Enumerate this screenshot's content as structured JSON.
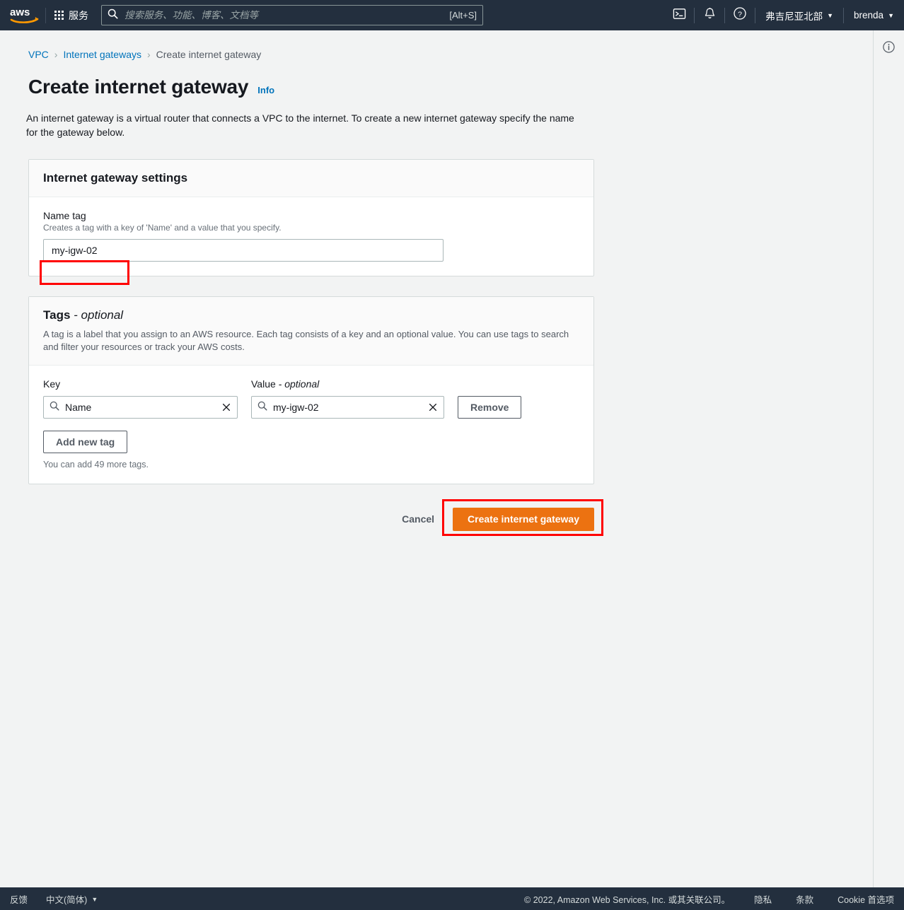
{
  "topnav": {
    "logo_alt": "aws",
    "services_label": "服务",
    "search_placeholder": "搜索服务、功能、博客、文档等",
    "search_value": "",
    "search_shortcut": "[Alt+S]",
    "cloudshell_icon": "terminal-icon",
    "notifications_icon": "bell-icon",
    "help_icon": "question-circle-icon",
    "region_label": "弗吉尼亚北部",
    "account_label": "brenda",
    "caret": "▼"
  },
  "breadcrumb": {
    "items": [
      {
        "label": "VPC",
        "current": false
      },
      {
        "label": "Internet gateways",
        "current": false
      },
      {
        "label": "Create internet gateway",
        "current": true
      }
    ],
    "separator": "›"
  },
  "header": {
    "title": "Create internet gateway",
    "info_label": "Info",
    "description": "An internet gateway is a virtual router that connects a VPC to the internet. To create a new internet gateway specify the name for the gateway below."
  },
  "settings_panel": {
    "title": "Internet gateway settings",
    "name_tag_label": "Name tag",
    "name_tag_hint": "Creates a tag with a key of 'Name' and a value that you specify.",
    "name_tag_value": "my-igw-02",
    "name_tag_placeholder": ""
  },
  "tags_panel": {
    "title_main": "Tags",
    "title_optional": " - optional",
    "description": "A tag is a label that you assign to an AWS resource. Each tag consists of a key and an optional value. You can use tags to search and filter your resources or track your AWS costs.",
    "column_key": "Key",
    "column_value_main": "Value",
    "column_value_optional": " - optional",
    "rows": [
      {
        "key": "Name",
        "value": "my-igw-02",
        "remove_label": "Remove",
        "key_icon": "search-icon",
        "value_icon": "search-icon",
        "clear_icon": "close-x-icon"
      }
    ],
    "add_tag_label": "Add new tag",
    "tag_count_text": "You can add 49 more tags."
  },
  "actions": {
    "cancel_label": "Cancel",
    "create_label": "Create internet gateway",
    "primary_color": "#ec7211"
  },
  "right_rail": {
    "info_icon": "info-circle-icon"
  },
  "annotations": {
    "color": "#ff0000",
    "boxes": [
      {
        "name": "name-tag-input-highlight"
      },
      {
        "name": "create-button-highlight"
      }
    ]
  },
  "footer": {
    "feedback_label": "反馈",
    "language_label": "中文(简体)",
    "language_caret": "▼",
    "copyright": "© 2022, Amazon Web Services, Inc. 或其关联公司。",
    "privacy_label": "隐私",
    "terms_label": "条款",
    "cookie_label": "Cookie 首选项"
  }
}
